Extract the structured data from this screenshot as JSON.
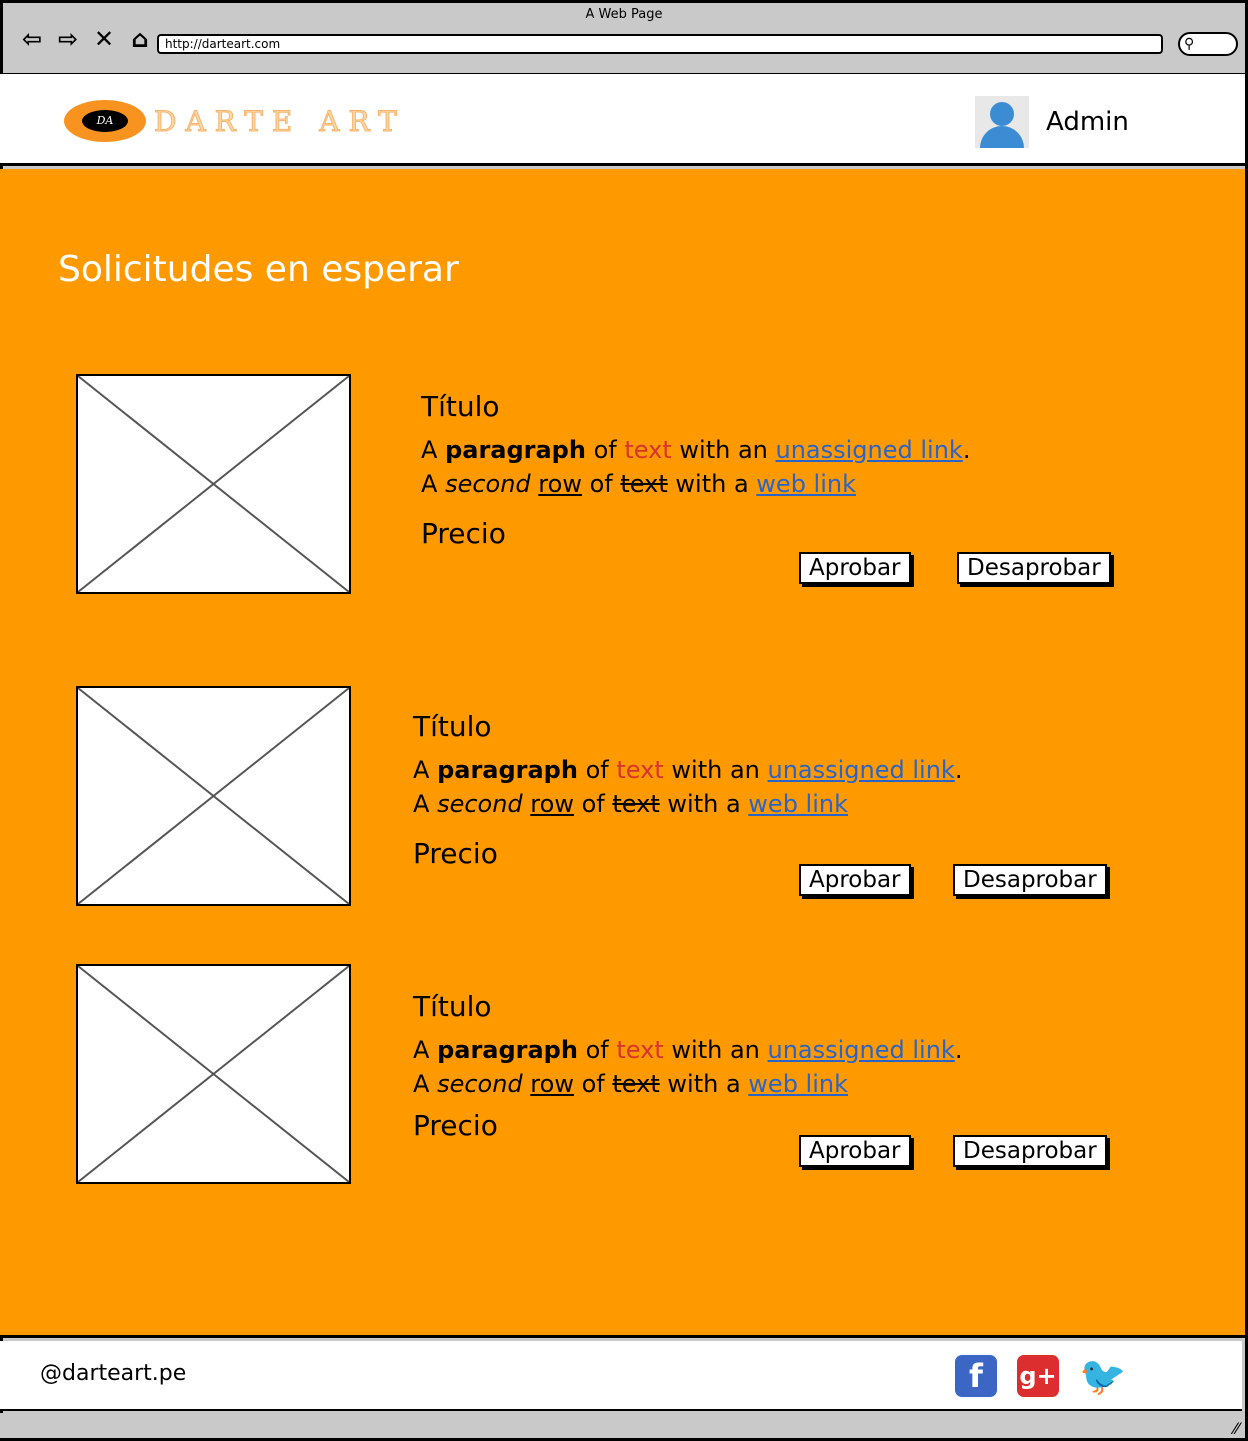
{
  "browser": {
    "window_title": "A Web Page",
    "url": "http://darteart.com",
    "icons": [
      "back-icon",
      "forward-icon",
      "close-icon",
      "home-icon",
      "search-icon"
    ]
  },
  "header": {
    "logo_badge": "DA",
    "logo_text": "DARTE ART",
    "user_name": "Admin",
    "accent_color": "#ff9900"
  },
  "main": {
    "title": "Solicitudes en esperar",
    "cards": [
      {
        "title": "Título",
        "line1": {
          "a": "A",
          "paragraph": "paragraph",
          "of": "of",
          "text": "text",
          "with_an": "with an",
          "link": "unassigned link",
          "end": "."
        },
        "line2": {
          "a": "A",
          "second": "second",
          "row": "row",
          "of": "of",
          "text": "text",
          "with_a": "with a",
          "link": "web link"
        },
        "price": "Precio",
        "approve": "Aprobar",
        "reject": "Desaprobar"
      },
      {
        "title": "Título",
        "line1": {
          "a": "A",
          "paragraph": "paragraph",
          "of": "of",
          "text": "text",
          "with_an": "with an",
          "link": "unassigned link",
          "end": "."
        },
        "line2": {
          "a": "A",
          "second": "second",
          "row": "row",
          "of": "of",
          "text": "text",
          "with_a": "with a",
          "link": "web link"
        },
        "price": "Precio",
        "approve": "Aprobar",
        "reject": "Desaprobar"
      },
      {
        "title": "Título",
        "line1": {
          "a": "A",
          "paragraph": "paragraph",
          "of": "of",
          "text": "text",
          "with_an": "with an",
          "link": "unassigned link",
          "end": "."
        },
        "line2": {
          "a": "A",
          "second": "second",
          "row": "row",
          "of": "of",
          "text": "text",
          "with_a": "with a",
          "link": "web link"
        },
        "price": "Precio",
        "approve": "Aprobar",
        "reject": "Desaprobar"
      }
    ]
  },
  "footer": {
    "handle": "@darteart.pe",
    "social": {
      "facebook": "f",
      "googleplus": "g+",
      "twitter": "🐦"
    }
  }
}
